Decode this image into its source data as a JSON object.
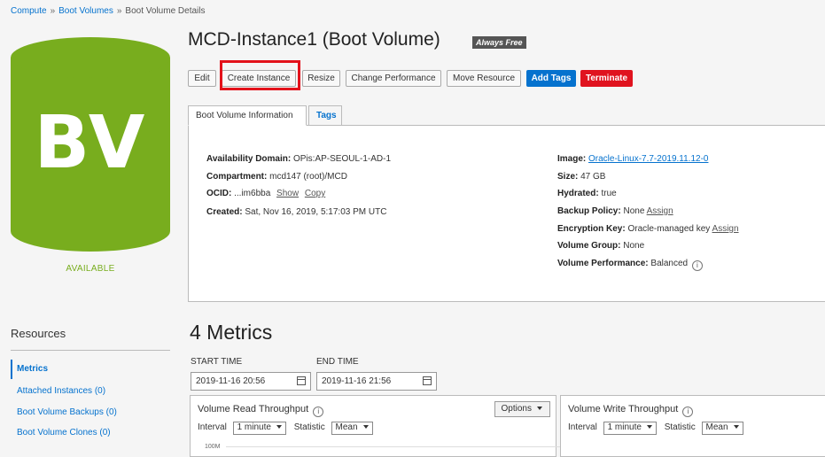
{
  "breadcrumb": {
    "items": [
      "Compute",
      "Boot Volumes",
      "Boot Volume Details"
    ],
    "sep": "»"
  },
  "status": {
    "abbr": "BV",
    "state": "AVAILABLE",
    "color": "#78ad1e"
  },
  "header": {
    "title": "MCD-Instance1 (Boot Volume)",
    "badge": "Always Free"
  },
  "actions": {
    "edit": "Edit",
    "create_instance": "Create Instance",
    "resize": "Resize",
    "change_performance": "Change Performance",
    "move_resource": "Move Resource",
    "add_tags": "Add Tags",
    "terminate": "Terminate"
  },
  "tabs": {
    "info": "Boot Volume Information",
    "tags": "Tags"
  },
  "info": {
    "availability_domain": {
      "label": "Availability Domain:",
      "value": "OPis:AP-SEOUL-1-AD-1"
    },
    "compartment": {
      "label": "Compartment:",
      "value": "mcd147 (root)/MCD"
    },
    "ocid": {
      "label": "OCID:",
      "value": "...im6bba",
      "show": "Show",
      "copy": "Copy"
    },
    "created": {
      "label": "Created:",
      "value": "Sat, Nov 16, 2019, 5:17:03 PM UTC"
    },
    "image": {
      "label": "Image:",
      "value": "Oracle-Linux-7.7-2019.11.12-0"
    },
    "size": {
      "label": "Size:",
      "value": "47 GB"
    },
    "hydrated": {
      "label": "Hydrated:",
      "value": "true"
    },
    "backup_policy": {
      "label": "Backup Policy:",
      "value": "None",
      "action": "Assign"
    },
    "encryption_key": {
      "label": "Encryption Key:",
      "value": "Oracle-managed key",
      "action": "Assign"
    },
    "volume_group": {
      "label": "Volume Group:",
      "value": "None"
    },
    "volume_performance": {
      "label": "Volume Performance:",
      "value": "Balanced"
    }
  },
  "resources": {
    "title": "Resources",
    "items": [
      "Metrics",
      "Attached Instances (0)",
      "Boot Volume Backups (0)",
      "Boot Volume Clones (0)"
    ]
  },
  "metrics": {
    "title": "4 Metrics",
    "start_label": "START TIME",
    "start_value": "2019-11-16 20:56",
    "end_label": "END TIME",
    "end_value": "2019-11-16 21:56",
    "charts": [
      {
        "title": "Volume Read Throughput",
        "interval_label": "Interval",
        "interval": "1 minute",
        "statistic_label": "Statistic",
        "statistic": "Mean",
        "options": "Options",
        "tick": "100M"
      },
      {
        "title": "Volume Write Throughput",
        "interval_label": "Interval",
        "interval": "1 minute",
        "statistic_label": "Statistic",
        "statistic": "Mean"
      }
    ]
  }
}
